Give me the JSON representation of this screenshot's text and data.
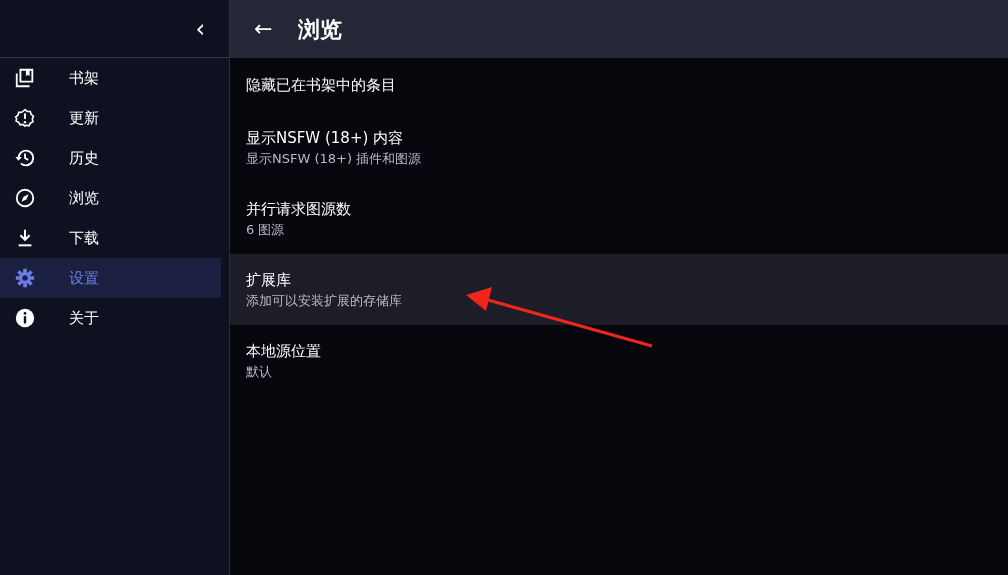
{
  "sidebar": {
    "collapse": "‹",
    "items": [
      {
        "label": "书架",
        "selected": false
      },
      {
        "label": "更新",
        "selected": false
      },
      {
        "label": "历史",
        "selected": false
      },
      {
        "label": "浏览",
        "selected": false
      },
      {
        "label": "下载",
        "selected": false
      },
      {
        "label": "设置",
        "selected": true
      },
      {
        "label": "关于",
        "selected": false
      }
    ]
  },
  "header": {
    "back": "←",
    "title": "浏览"
  },
  "settings": [
    {
      "title": "隐藏已在书架中的条目",
      "highlighted": false
    },
    {
      "title": "显示NSFW (18+) 内容",
      "subtitle": "显示NSFW (18+) 插件和图源",
      "highlighted": false
    },
    {
      "title": "并行请求图源数",
      "subtitle": "6 图源",
      "highlighted": false
    },
    {
      "title": "扩展库",
      "subtitle": "添加可以安装扩展的存储库",
      "highlighted": true
    },
    {
      "title": "本地源位置",
      "subtitle": "默认",
      "highlighted": false
    }
  ]
}
